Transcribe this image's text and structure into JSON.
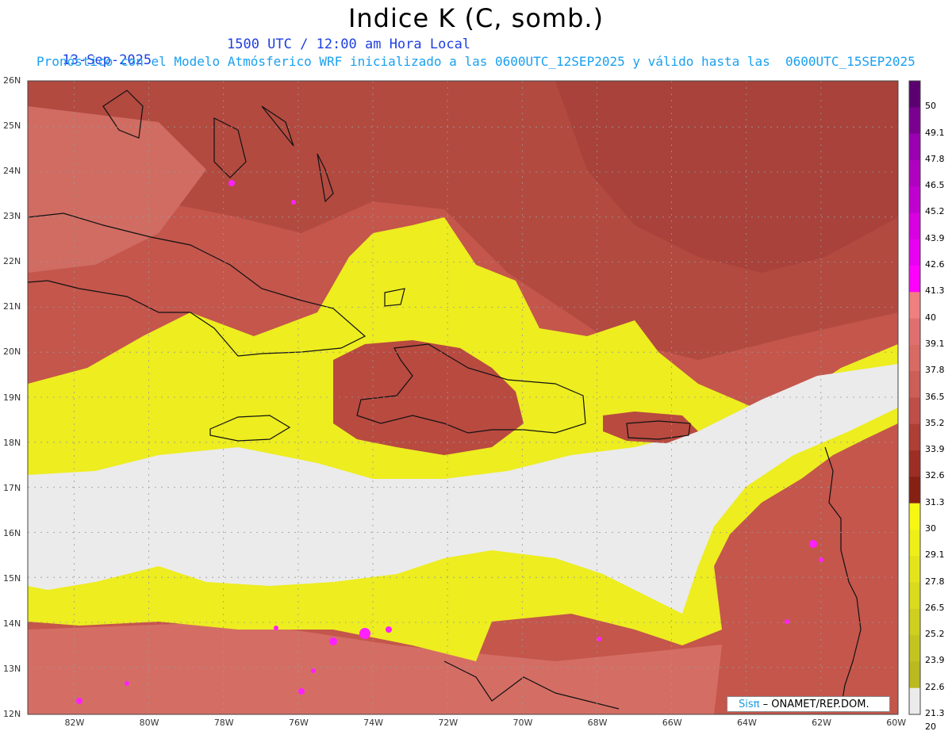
{
  "title": "Indice K (C, somb.)",
  "header": {
    "date": "13-Sep-2025",
    "time": "1500 UTC / 12:00 am Hora Local",
    "forecast_line": "Pronóstico con el Modelo Atmósferico WRF inicializado a las 0600UTC_12SEP2025 y válido hasta las  0600UTC_15SEP2025"
  },
  "map": {
    "lat_labels": [
      "26N",
      "25N",
      "24N",
      "23N",
      "22N",
      "21N",
      "20N",
      "19N",
      "18N",
      "17N",
      "16N",
      "15N",
      "14N",
      "13N",
      "12N"
    ],
    "lon_labels": [
      "82W",
      "80W",
      "78W",
      "76W",
      "74W",
      "72W",
      "70W",
      "68W",
      "66W",
      "64W",
      "62W",
      "60W"
    ],
    "lat_range": [
      12,
      26
    ],
    "lon_range": [
      -83.2,
      -59.9
    ],
    "grid": true
  },
  "colorbar": {
    "labels": [
      "50",
      "49.1",
      "47.8",
      "46.5",
      "45.2",
      "43.9",
      "42.6",
      "41.3",
      "40",
      "39.1",
      "37.8",
      "36.5",
      "35.2",
      "33.9",
      "32.6",
      "31.3",
      "30",
      "29.1",
      "27.8",
      "26.5",
      "25.2",
      "23.9",
      "22.6",
      "21.3",
      "20"
    ],
    "colors": [
      "#5a0070",
      "#7a0090",
      "#9a00b0",
      "#b000c0",
      "#c000d0",
      "#d800e0",
      "#e800f0",
      "#ff00ff",
      "#f08080",
      "#e07070",
      "#d86a64",
      "#cc5e58",
      "#be4e48",
      "#ae3e36",
      "#9c2e24",
      "#862012",
      "#f7f714",
      "#eeee18",
      "#e4e41c",
      "#dada1e",
      "#cfcf20",
      "#c4c420",
      "#baba20",
      "#ebebeb"
    ]
  },
  "credit": {
    "logo": "Sisπ",
    "text": "– ONAMET/REP.DOM."
  }
}
